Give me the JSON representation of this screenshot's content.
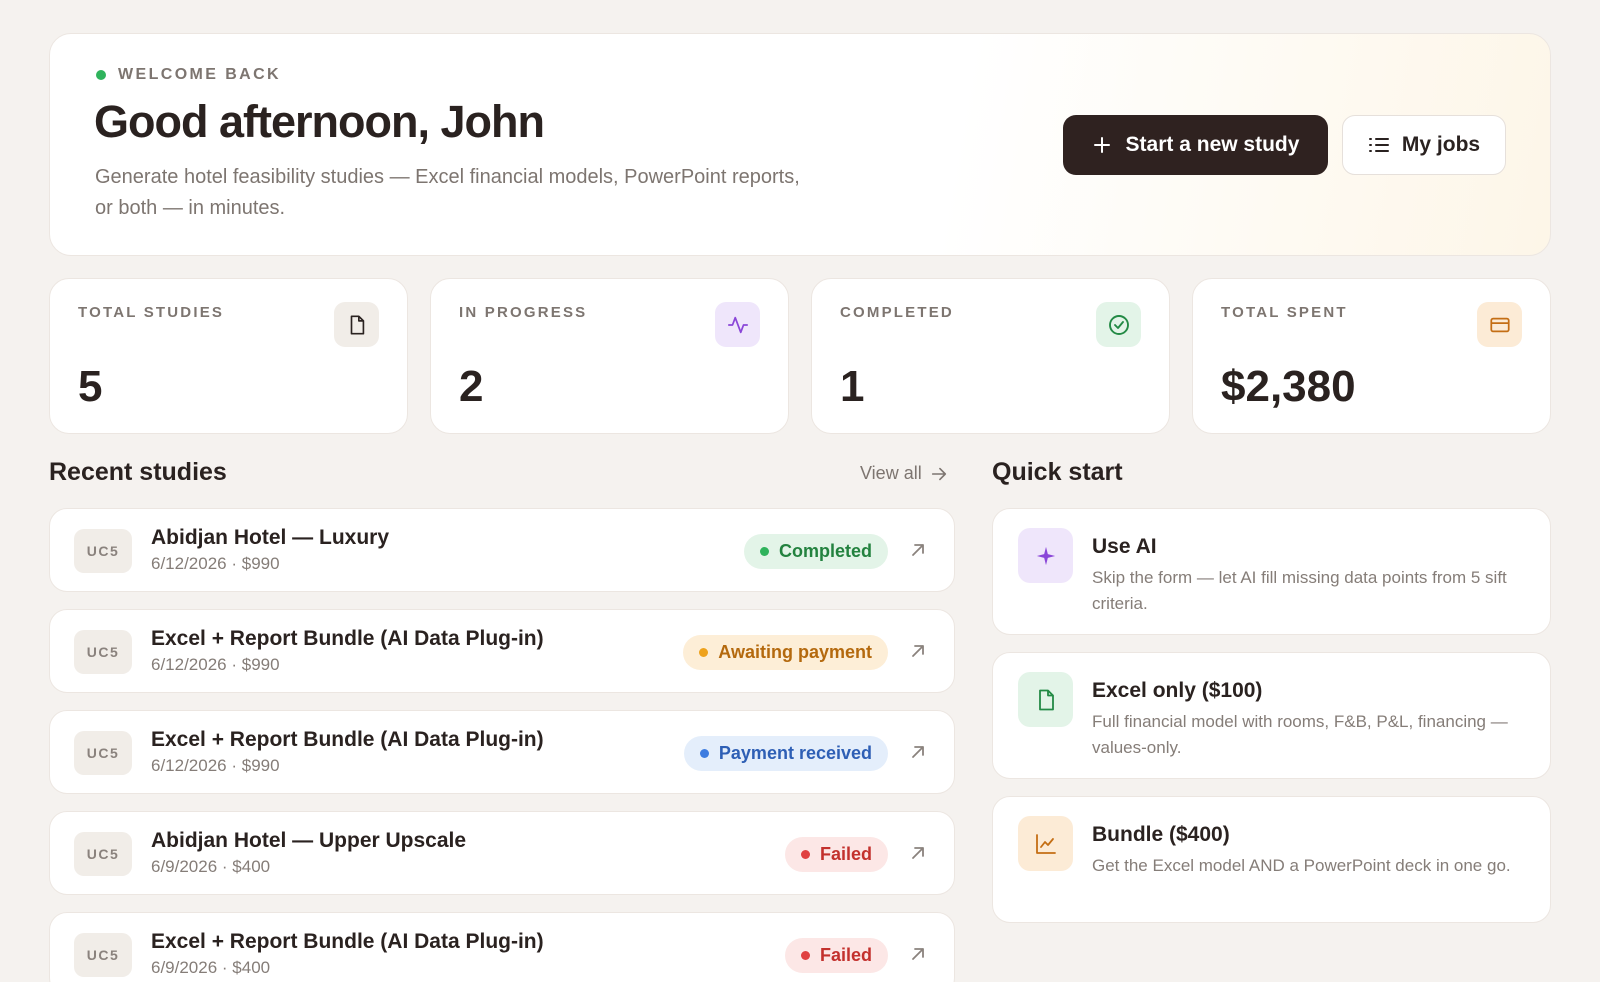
{
  "hero": {
    "eyebrow": "WELCOME BACK",
    "title": "Good afternoon, John",
    "subtitle": "Generate hotel feasibility studies — Excel financial models, PowerPoint reports, or both — in minutes.",
    "primary_button": "Start a new study",
    "secondary_button": "My jobs"
  },
  "stats": [
    {
      "label": "TOTAL STUDIES",
      "value": "5",
      "icon": "document-icon",
      "icon_bg": "#f1ede8",
      "icon_color": "#2a2220"
    },
    {
      "label": "IN PROGRESS",
      "value": "2",
      "icon": "activity-icon",
      "icon_bg": "#efe6fb",
      "icon_color": "#8a46d8"
    },
    {
      "label": "COMPLETED",
      "value": "1",
      "icon": "check-circle-icon",
      "icon_bg": "#e3f4e8",
      "icon_color": "#238a45"
    },
    {
      "label": "TOTAL SPENT",
      "value": "$2,380",
      "icon": "credit-card-icon",
      "icon_bg": "#fcebd6",
      "icon_color": "#c46e14"
    }
  ],
  "recent": {
    "title": "Recent studies",
    "view_all": "View all",
    "items": [
      {
        "tag": "UC5",
        "title": "Abidjan Hotel — Luxury",
        "meta": "6/12/2026 · $990",
        "status": "Completed",
        "status_bg": "#e3f4e8",
        "status_color": "#23823f",
        "dot": "#2fb35c"
      },
      {
        "tag": "UC5",
        "title": "Excel + Report Bundle (AI Data Plug-in)",
        "meta": "6/12/2026 · $990",
        "status": "Awaiting payment",
        "status_bg": "#fdeed7",
        "status_color": "#b4690e",
        "dot": "#eea21c"
      },
      {
        "tag": "UC5",
        "title": "Excel + Report Bundle (AI Data Plug-in)",
        "meta": "6/12/2026 · $990",
        "status": "Payment received",
        "status_bg": "#e4eefb",
        "status_color": "#2e5fb5",
        "dot": "#3d7ce0"
      },
      {
        "tag": "UC5",
        "title": "Abidjan Hotel — Upper Upscale",
        "meta": "6/9/2026 · $400",
        "status": "Failed",
        "status_bg": "#fce7e6",
        "status_color": "#c3312d",
        "dot": "#e04040"
      },
      {
        "tag": "UC5",
        "title": "Excel + Report Bundle (AI Data Plug-in)",
        "meta": "6/9/2026 · $400",
        "status": "Failed",
        "status_bg": "#fce7e6",
        "status_color": "#c3312d",
        "dot": "#e04040"
      }
    ]
  },
  "quick_start": {
    "title": "Quick start",
    "items": [
      {
        "title": "Use AI",
        "desc": "Skip the form — let AI fill missing data points from 5 sift criteria.",
        "icon": "sparkle-icon",
        "icon_bg": "#efe6fb",
        "icon_color": "#8a46d8"
      },
      {
        "title": "Excel only ($100)",
        "desc": "Full financial model with rooms, F&B, P&L, financing — values-only.",
        "icon": "document-icon",
        "icon_bg": "#e3f4e8",
        "icon_color": "#238a45"
      },
      {
        "title": "Bundle ($400)",
        "desc": "Get the Excel model AND a PowerPoint deck in one go.",
        "icon": "chart-line-icon",
        "icon_bg": "#fcebd6",
        "icon_color": "#c46e14"
      }
    ]
  }
}
